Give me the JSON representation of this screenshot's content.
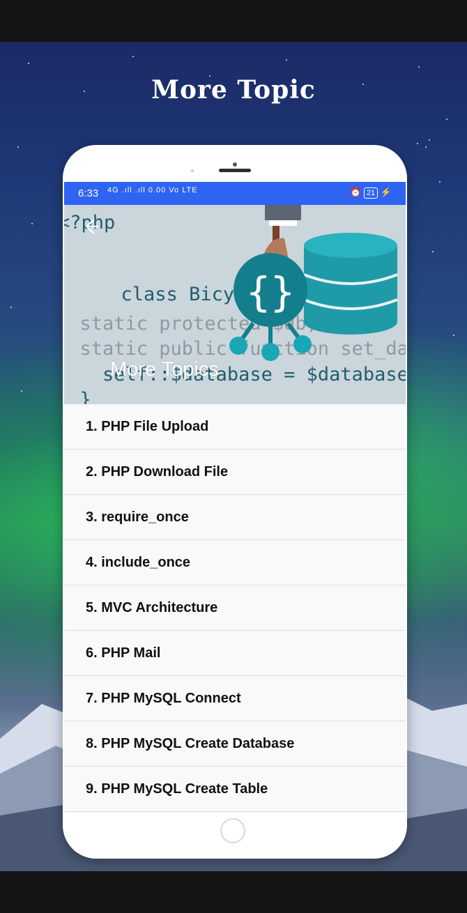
{
  "headline": "More Topic",
  "status_bar": {
    "time": "6:33",
    "signal": "4G .ıll .ıll 0.00 Vo LTE",
    "battery": "21"
  },
  "app": {
    "title": "More Topics",
    "back_icon": "arrow-left-icon",
    "header_code_lines": [
      "<?php",
      "class Bicycle {",
      "  static protected $db;",
      "  static public function set_database($database) {",
      "    self::$database = $database;",
      "  }"
    ]
  },
  "topics": [
    "1. PHP File Upload",
    "2. PHP Download File",
    "3. require_once",
    "4. include_once",
    "5. MVC Architecture",
    "6. PHP Mail",
    "7. PHP MySQL Connect",
    "8. PHP MySQL Create Database",
    "9. PHP MySQL Create Table"
  ],
  "colors": {
    "status_bar": "#2f63f2",
    "code_dark": "#1f5f6b",
    "code_light": "#8e9aa3",
    "db_teal": "#1f9ba8"
  }
}
